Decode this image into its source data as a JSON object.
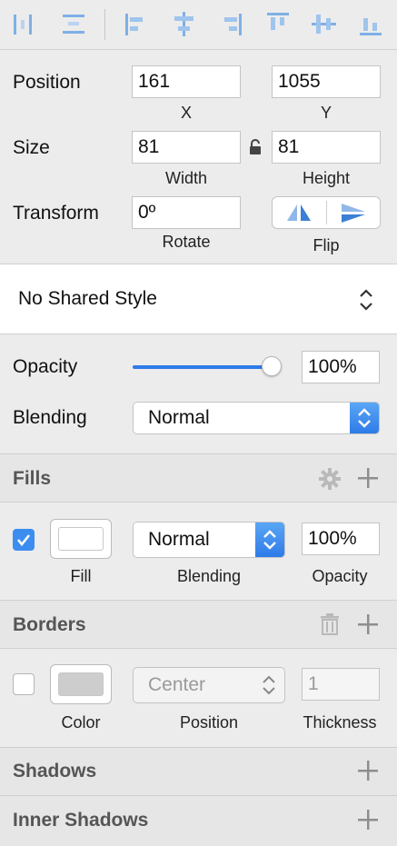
{
  "position": {
    "label": "Position",
    "x": "161",
    "y": "1055",
    "x_caption": "X",
    "y_caption": "Y"
  },
  "size": {
    "label": "Size",
    "width": "81",
    "height": "81",
    "width_caption": "Width",
    "height_caption": "Height"
  },
  "transform": {
    "label": "Transform",
    "rotate": "0º",
    "rotate_caption": "Rotate",
    "flip_caption": "Flip"
  },
  "shared_style": {
    "value": "No Shared Style"
  },
  "opacity": {
    "label": "Opacity",
    "value": "100%",
    "level": 1.0
  },
  "blending": {
    "label": "Blending",
    "value": "Normal"
  },
  "fills": {
    "title": "Fills",
    "blending": "Normal",
    "opacity": "100%",
    "fill_caption": "Fill",
    "blending_caption": "Blending",
    "opacity_caption": "Opacity",
    "enabled": true
  },
  "borders": {
    "title": "Borders",
    "position": "Center",
    "thickness_placeholder": "1",
    "color_caption": "Color",
    "position_caption": "Position",
    "thickness_caption": "Thickness",
    "enabled": false
  },
  "shadows": {
    "title": "Shadows"
  },
  "inner_shadows": {
    "title": "Inner Shadows"
  },
  "colors": {
    "accent": "#2f7be8",
    "checkbox": "#3b8df0"
  }
}
